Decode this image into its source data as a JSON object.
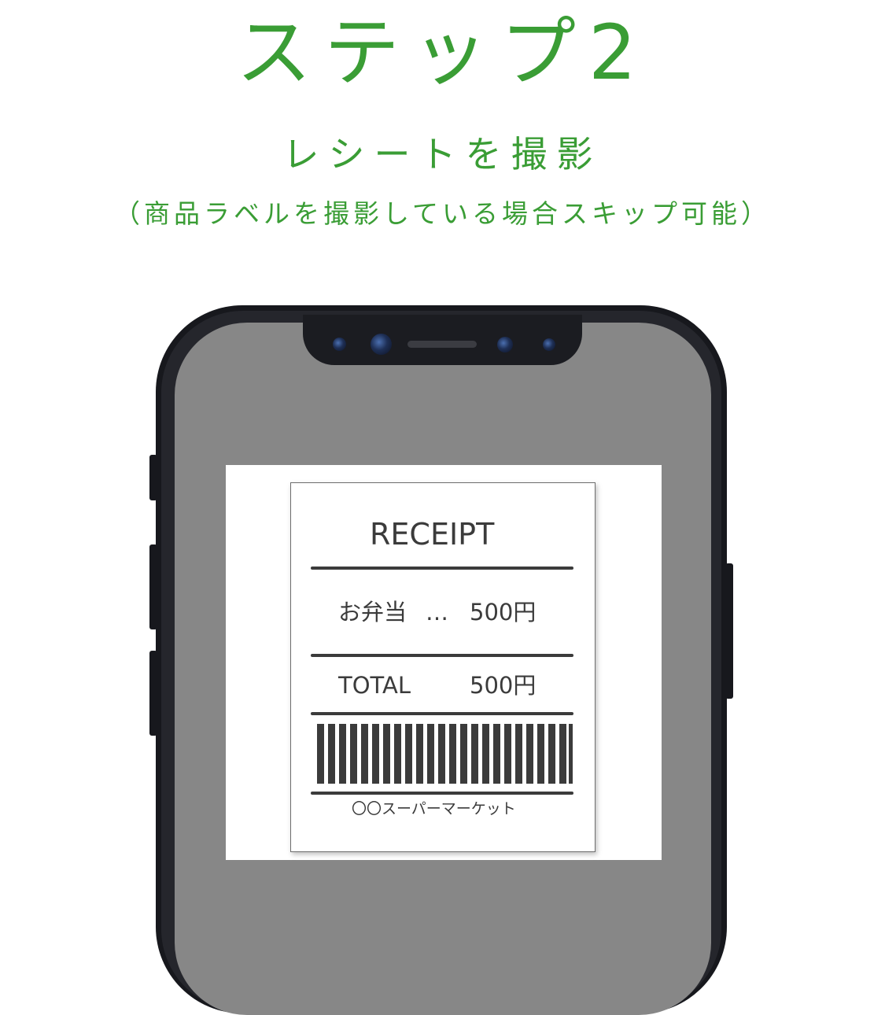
{
  "header": {
    "step": "ステップ2",
    "subtitle": "レシートを撮影",
    "note": "（商品ラベルを撮影している場合スキップ可能）"
  },
  "receipt": {
    "title": "RECEIPT",
    "item_name": "お弁当",
    "item_dots": "…",
    "item_price": "500円",
    "total_label": "TOTAL",
    "total_price": "500円",
    "store": "〇〇スーパーマーケット"
  },
  "colors": {
    "accent": "#3a9d35",
    "phone": "#17181d",
    "screen": "#878787",
    "ink": "#3b3b3b"
  }
}
